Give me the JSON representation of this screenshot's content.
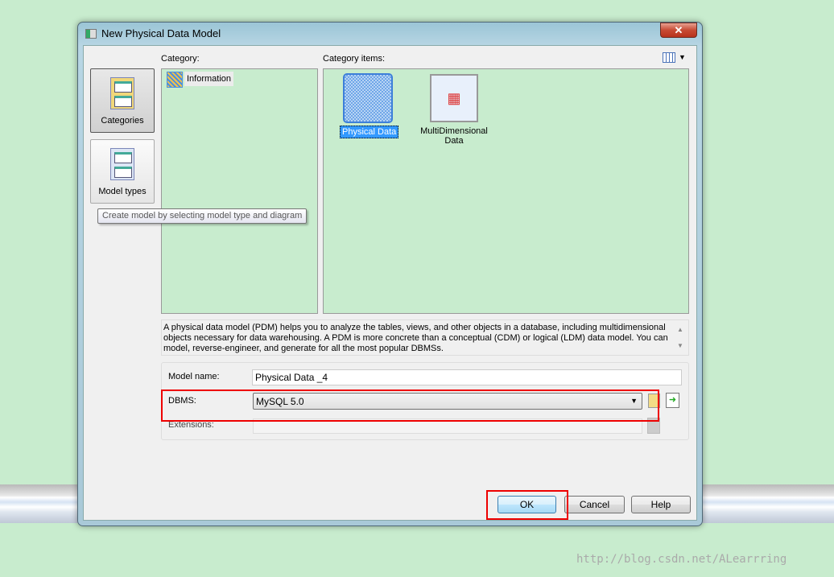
{
  "window": {
    "title": "New Physical Data Model",
    "close_label": "✕"
  },
  "nav": {
    "categories_label": "Categories",
    "model_types_label": "Model types",
    "tooltip": "Create model by selecting model type and diagram"
  },
  "category": {
    "label": "Category:",
    "items": [
      "Information"
    ]
  },
  "category_items": {
    "label": "Category items:",
    "items": [
      {
        "label": "Physical Data",
        "selected": true
      },
      {
        "label_line1": "MultiDimensional",
        "label_line2": "Data"
      }
    ]
  },
  "description": "A physical data model (PDM) helps you to analyze the tables, views, and other objects in a database, including multidimensional objects necessary for data warehousing. A PDM is more concrete than a conceptual (CDM) or logical (LDM) data model. You can model, reverse-engineer, and generate for all the most popular DBMSs.",
  "form": {
    "model_name_label": "Model name:",
    "model_name_value": "Physical Data _4",
    "dbms_label": "DBMS:",
    "dbms_value": "MySQL 5.0",
    "extensions_label": "Extensions:",
    "extensions_value": ""
  },
  "buttons": {
    "ok": "OK",
    "cancel": "Cancel",
    "help": "Help"
  },
  "watermark": "http://blog.csdn.net/ALearrring",
  "colors": {
    "background": "#c8ecce",
    "highlight": "#d00000",
    "selection": "#3399ff"
  }
}
